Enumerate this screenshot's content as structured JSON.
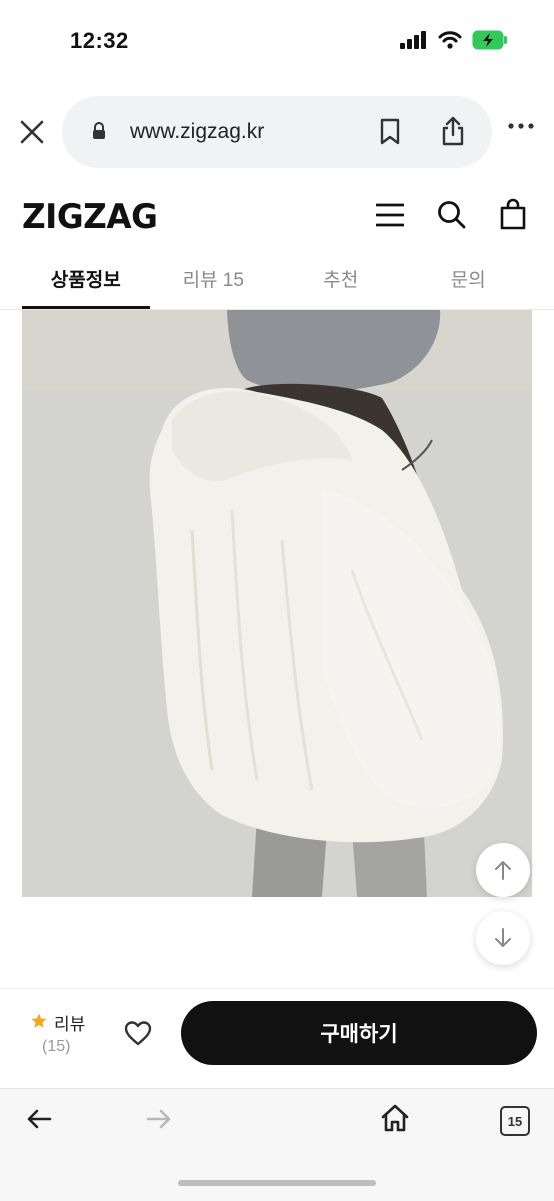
{
  "status_bar": {
    "time": "12:32"
  },
  "browser": {
    "url": "www.zigzag.kr",
    "tab_count": "15"
  },
  "site": {
    "logo": "ZIGZAG"
  },
  "tabs": [
    {
      "label": "상품정보",
      "active": true
    },
    {
      "label": "리뷰 15",
      "active": false
    },
    {
      "label": "추천",
      "active": false
    },
    {
      "label": "문의",
      "active": false
    }
  ],
  "purchase_bar": {
    "review_label": "리뷰",
    "review_count": "(15)",
    "buy_label": "구매하기"
  },
  "colors": {
    "accent_star": "#f5a623",
    "buy_button_bg": "#111111",
    "battery_green": "#34c759"
  }
}
